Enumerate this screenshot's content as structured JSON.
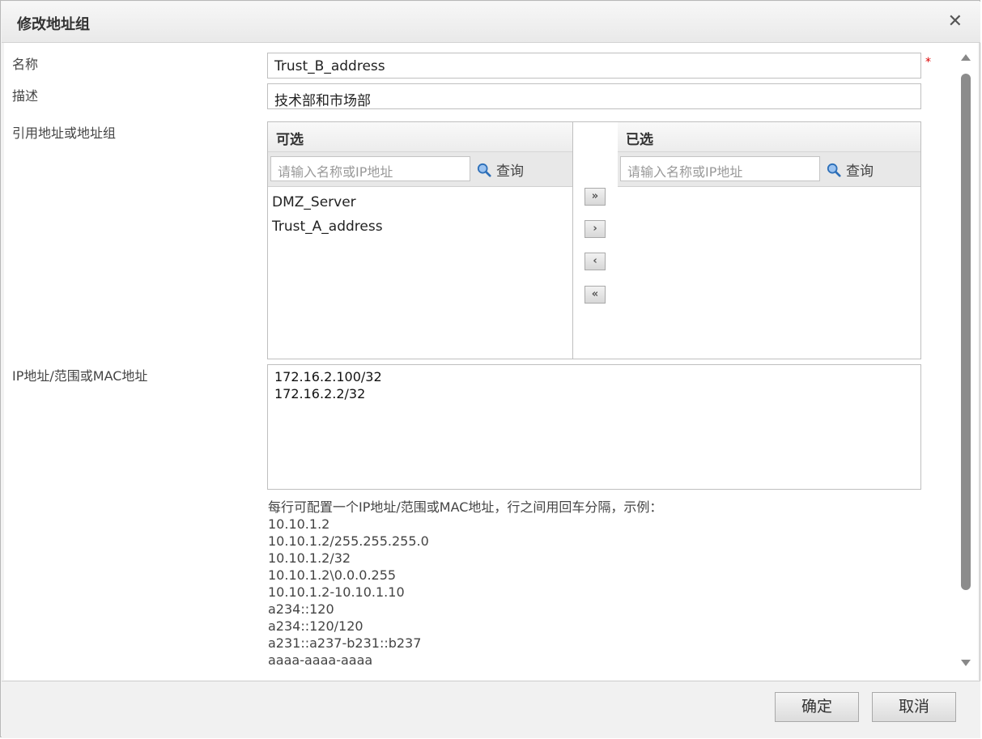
{
  "dialog": {
    "title": "修改地址组",
    "close_icon": "close-icon"
  },
  "fields": {
    "name_label": "名称",
    "name_value": "Trust_B_address",
    "required_mark": "*",
    "desc_label": "描述",
    "desc_value": "技术部和市场部",
    "ref_label": "引用地址或地址组",
    "ip_label": "IP地址/范围或MAC地址"
  },
  "selector": {
    "available": {
      "title": "可选",
      "search_placeholder": "请输入名称或IP地址",
      "search_button": "查询",
      "items": [
        "DMZ_Server",
        "Trust_A_address"
      ]
    },
    "selected": {
      "title": "已选",
      "search_placeholder": "请输入名称或IP地址",
      "search_button": "查询",
      "items": []
    },
    "buttons": {
      "add_all": "»",
      "add": "›",
      "remove": "‹",
      "remove_all": "«"
    }
  },
  "ip_entries": [
    "172.16.2.100/32",
    "172.16.2.2/32"
  ],
  "hint": {
    "intro": "每行可配置一个IP地址/范围或MAC地址，行之间用回车分隔，示例：",
    "examples": [
      "10.10.1.2",
      "10.10.1.2/255.255.255.0",
      "10.10.1.2/32",
      "10.10.1.2\\0.0.0.255",
      "10.10.1.2-10.10.1.10",
      "a234::120",
      "a234::120/120",
      "a231::a237-b231::b237",
      "aaaa-aaaa-aaaa"
    ]
  },
  "footer": {
    "ok": "确定",
    "cancel": "取消"
  },
  "colors": {
    "border": "#bfbfbf",
    "required": "#dd0000",
    "scroll_thumb": "#8c8c8c"
  }
}
